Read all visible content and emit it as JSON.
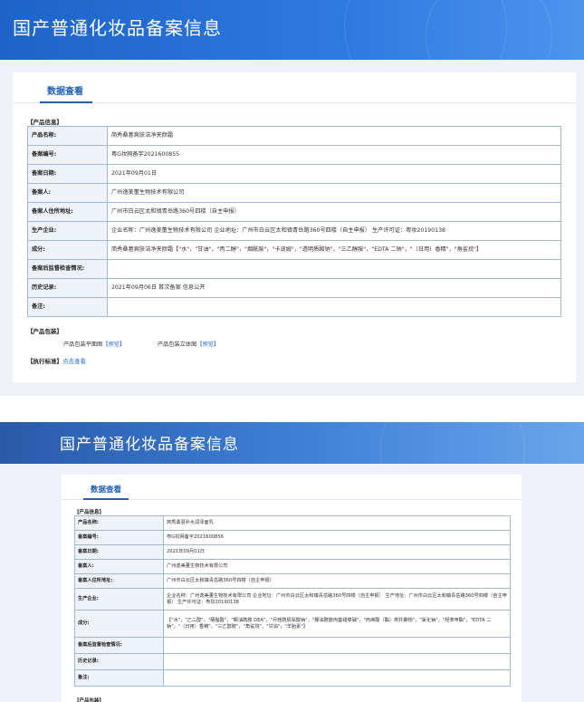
{
  "banner_title": "国产普通化妆品备案信息",
  "tab_label": "数据查看",
  "product_info_label": "【产品信息】",
  "package_label": "【产品包装】",
  "exec_label": "【执行标准】",
  "exec_link": "点击查看",
  "package": {
    "flat_label": "产品包装平面图",
    "flat_link": "【预览】",
    "solid_label": "产品包装立体图",
    "solid_link": "【预览】"
  },
  "screen1_rows": [
    {
      "label": "产品名称:",
      "value": "简秀桑葚爽肤洁净夹颜霜"
    },
    {
      "label": "备案编号:",
      "value": "粤G妆网备字2021600855"
    },
    {
      "label": "备案日期:",
      "value": "2021年09月01日"
    },
    {
      "label": "备案人:",
      "value": "广州逸美董生物技术有限公司"
    },
    {
      "label": "备案人住所地址:",
      "value": "广州市白云区太和镇青岳路360号四楼（自主申报）"
    },
    {
      "label": "生产企业:",
      "value": "企业名称：广州逸美董生物技术有限公司  企业地址：广州市白云区太和镇青岳路360号四楼（自主申报）  生产许可证：粤妆20190138"
    },
    {
      "label": "成分:",
      "value": "简秀桑葚爽肤洁净夹颜霜【\"水\"，\"甘油\"，\"丙二醇\"，\"烟酰胺\"，\"卡波姆\"，\"透明质酸钠\"，\"三乙醇胺\"，\"EDTA 二钠\"，\"（日用）香精\"，\"角鲨烷\"】"
    },
    {
      "label": "备案后监督检查情况:",
      "value": ""
    },
    {
      "label": "历史记录:",
      "value": "2021年09月06日 首次备案 信息公开"
    },
    {
      "label": "备注:",
      "value": ""
    }
  ],
  "screen2_rows": [
    {
      "label": "产品名称:",
      "value": "简秀桑葚补水润泽面乳"
    },
    {
      "label": "备案编号:",
      "value": "粤G妆网备字2021600856"
    },
    {
      "label": "备案日期:",
      "value": "2021年09月01日"
    },
    {
      "label": "备案人:",
      "value": "广州逸美董生物技术有限公司"
    },
    {
      "label": "备案人住所地址:",
      "value": "广州市白云区太和镇青岳路360号四楼（自主申报）"
    },
    {
      "label": "生产企业:",
      "value": "企业名称：广州逸美董生物技术有限公司  企业地址：广州市白云区太和镇青岳路360号四楼（自主申报）  生产地址：广州市白云区太和镇青岳路360号四楼（自主申报）  生产许可证：粤妆20190138"
    },
    {
      "label": "成分:",
      "value": "【\"水\"，\"乙二醇\"，\"硬脂酸\"，\"椰油酰胺 DEA\"，\"月桂酰肌氨酸钠\"，\"椰油酰胺丙基甜菜碱\"，\"丙烯酸（酯）类共聚物\"，\"氯化钠\"，\"羟苯甲酯\"，\"EDTA 二钠\"，\"（日用）香精\"，\"三乙醇胺\"，\"角鲨烷\"，\"甘油\"，\"羊胎素\"】"
    },
    {
      "label": "备案后监督检查情况:",
      "value": ""
    },
    {
      "label": "历史记录:",
      "value": ""
    },
    {
      "label": "备注:",
      "value": ""
    }
  ]
}
